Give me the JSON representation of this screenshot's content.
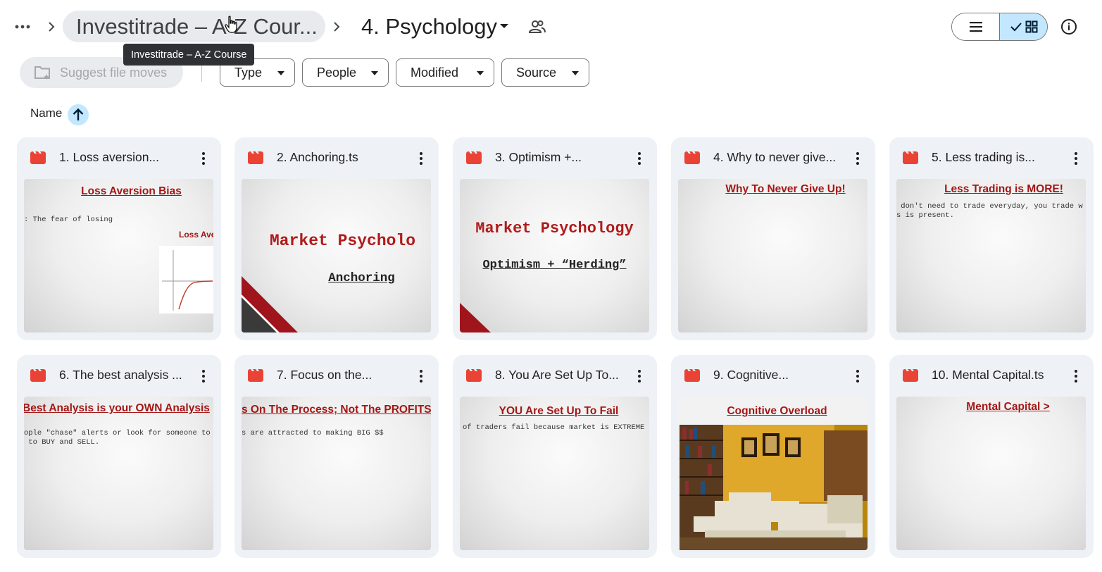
{
  "breadcrumb": {
    "parent_label": "Investitrade – A-Z Cour...",
    "current_label": "4. Psychology"
  },
  "tooltip": {
    "text": "Investitrade – A-Z Course"
  },
  "filters": {
    "suggest_label": "Suggest file moves",
    "chips": [
      {
        "label": "Type"
      },
      {
        "label": "People"
      },
      {
        "label": "Modified"
      },
      {
        "label": "Source"
      }
    ]
  },
  "sort": {
    "label": "Name",
    "direction": "ascending"
  },
  "colors": {
    "accent": "#c2e7ff",
    "video_icon": "#ea4335",
    "slide_red": "#a31616",
    "card_bg": "#eef1f6"
  },
  "files": [
    {
      "name": "1. Loss aversion...",
      "icon": "video-file-icon",
      "thumb": {
        "title": "Loss Aversion Bias",
        "body": ": The fear of losing",
        "extra": "Loss Ave"
      }
    },
    {
      "name": "2. Anchoring.ts",
      "icon": "video-file-icon",
      "thumb": {
        "big": "Market Psycholo",
        "sub": "Anchoring"
      }
    },
    {
      "name": "3. Optimism +...",
      "icon": "video-file-icon",
      "thumb": {
        "big": "Market Psychology",
        "sub": "Optimism + “Herding”"
      }
    },
    {
      "name": "4. Why to never give...",
      "icon": "video-file-icon",
      "thumb": {
        "title": "Why To Never Give Up!"
      }
    },
    {
      "name": "5. Less trading is...",
      "icon": "video-file-icon",
      "thumb": {
        "title": "Less Trading is MORE!",
        "body": " don't need to trade everyday, you trade w\ns is present."
      }
    },
    {
      "name": "6. The best analysis ...",
      "icon": "video-file-icon",
      "thumb": {
        "title": "Best Analysis is your OWN Analysis",
        "body": "ople \"chase\" alerts or look for someone to\n to BUY and SELL."
      }
    },
    {
      "name": "7. Focus on the...",
      "icon": "video-file-icon",
      "thumb": {
        "title": "s On The Process; Not The PROFITS",
        "body": "s are attracted to making BIG $$"
      }
    },
    {
      "name": "8. You Are Set Up To...",
      "icon": "video-file-icon",
      "thumb": {
        "title": "YOU Are Set Up To Fail",
        "body": "of traders fail because market is EXTREME"
      }
    },
    {
      "name": "9. Cognitive...",
      "icon": "video-file-icon",
      "thumb": {
        "title": "Cognitive Overload"
      }
    },
    {
      "name": "10. Mental Capital.ts",
      "icon": "video-file-icon",
      "thumb": {
        "title": "Mental Capital >"
      }
    }
  ]
}
